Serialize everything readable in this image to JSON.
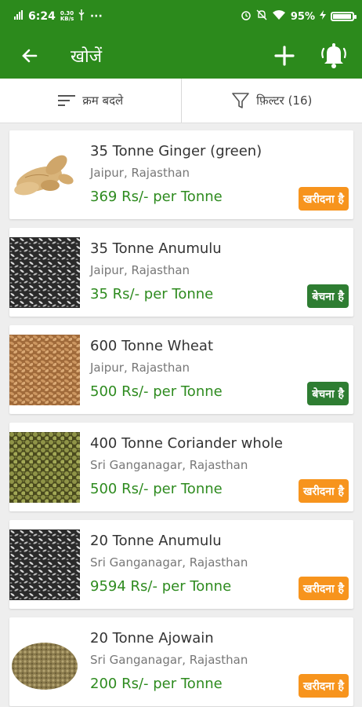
{
  "status_bar": {
    "time": "6:24",
    "data_speed": "0.30\nKB/s",
    "battery": "95%",
    "battery_level": 0.95
  },
  "app_bar": {
    "title": "खोजें",
    "back_icon": "arrow-left-icon",
    "add_icon": "plus-icon",
    "bell_icon": "bell-icon"
  },
  "toolbar": {
    "sort_label": "क्रम बदले",
    "filter_label": "फ़िल्टर (16)"
  },
  "colors": {
    "primary": "#2c8a1c",
    "price": "#2e8b1f",
    "buy_badge": "#f7941d",
    "sell_badge": "#2e7d32"
  },
  "listings": [
    {
      "title": "35 Tonne Ginger (green)",
      "location": "Jaipur, Rajasthan",
      "price": "369 Rs/- per Tonne",
      "badge": "खरीदना है",
      "badge_type": "buy",
      "image": "ginger"
    },
    {
      "title": "35 Tonne Anumulu",
      "location": "Jaipur, Rajasthan",
      "price": "35 Rs/- per Tonne",
      "badge": "बेचना है",
      "badge_type": "sell",
      "image": "black-seeds"
    },
    {
      "title": "600 Tonne Wheat",
      "location": "Jaipur, Rajasthan",
      "price": "500 Rs/- per Tonne",
      "badge": "बेचना है",
      "badge_type": "sell",
      "image": "wheat"
    },
    {
      "title": "400 Tonne Coriander whole",
      "location": "Sri Ganganagar, Rajasthan",
      "price": "500 Rs/- per Tonne",
      "badge": "खरीदना है",
      "badge_type": "buy",
      "image": "green-seeds"
    },
    {
      "title": "20 Tonne Anumulu",
      "location": "Sri Ganganagar, Rajasthan",
      "price": "9594 Rs/- per Tonne",
      "badge": "खरीदना है",
      "badge_type": "buy",
      "image": "black-seeds"
    },
    {
      "title": "20 Tonne Ajowain",
      "location": "Sri Ganganagar, Rajasthan",
      "price": "200 Rs/- per Tonne",
      "badge": "खरीदना है",
      "badge_type": "buy",
      "image": "ajowain"
    }
  ]
}
